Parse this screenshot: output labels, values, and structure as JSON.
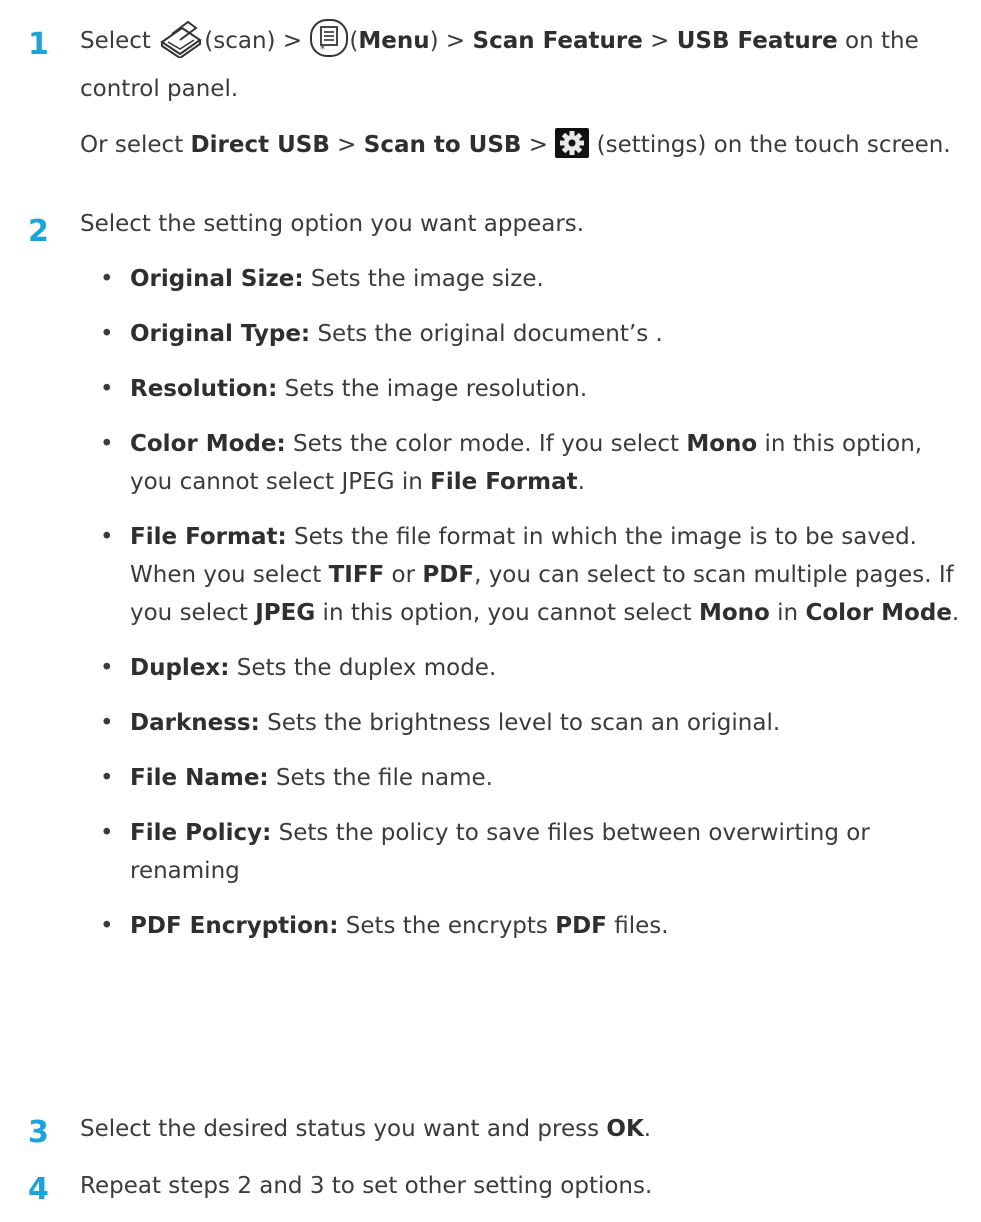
{
  "steps": [
    {
      "number": "1",
      "line1": {
        "prefix": "Select ",
        "scan": "(scan) > ",
        "menu_open": "(",
        "menu": "Menu",
        "menu_close": ") > ",
        "scan_feature": "Scan Feature",
        "sep": " > ",
        "usb_feature": "USB Feature",
        "suffix": " on the"
      },
      "line2": "control panel.",
      "alt": {
        "prefix": "Or select ",
        "direct_usb": "Direct USB",
        "sep1": " > ",
        "scan_to_usb": "Scan to USB",
        "sep2": " > ",
        "suffix": " (settings) on the touch screen."
      }
    },
    {
      "number": "2",
      "text": "Select the setting option you want appears.",
      "bullets": [
        {
          "term": "Original Size:",
          "desc": " Sets the image size."
        },
        {
          "term": "Original Type:",
          "desc": " Sets the original document’s ."
        },
        {
          "term": "Resolution:",
          "desc": " Sets the image resolution."
        },
        {
          "term": "Color Mode:",
          "desc1": " Sets the color mode. If you select ",
          "b1": "Mono",
          "desc2": " in this option, you cannot select JPEG in ",
          "b2": "File Format",
          "desc3": "."
        },
        {
          "term": "File Format:",
          "desc1": " Sets the file format in which the image is to be saved. When you select ",
          "b1": "TIFF",
          "desc2": " or ",
          "b2": "PDF",
          "desc3": ", you can select to scan multiple pages. If you select ",
          "b3": "JPEG",
          "desc4": " in this option, you cannot select ",
          "b4": "Mono",
          "desc5": " in ",
          "b5": "Color Mode",
          "desc6": "."
        },
        {
          "term": "Duplex:",
          "desc": " Sets the duplex mode."
        },
        {
          "term": "Darkness:",
          "desc": " Sets the brightness level to scan an original."
        },
        {
          "term": "File Name:",
          "desc": " Sets the file name."
        },
        {
          "term": "File Policy:",
          "desc": " Sets the policy to save files between overwirting or renaming"
        },
        {
          "term": "PDF Encryption:",
          "desc1": " Sets the encrypts ",
          "b1": "PDF",
          "desc2": " files."
        }
      ]
    },
    {
      "number": "3",
      "prefix": "Select the desired status you want and press ",
      "ok": "OK",
      "suffix": "."
    },
    {
      "number": "4",
      "text": "Repeat steps 2 and 3 to set other setting options."
    }
  ],
  "bullet_glyph": "•",
  "icons": [
    "scanner-icon",
    "menu-icon",
    "settings-gear-icon"
  ],
  "colors": {
    "step_number": "#1aa3dd",
    "text": "#3b3b3b",
    "gear_bg": "#111111"
  }
}
